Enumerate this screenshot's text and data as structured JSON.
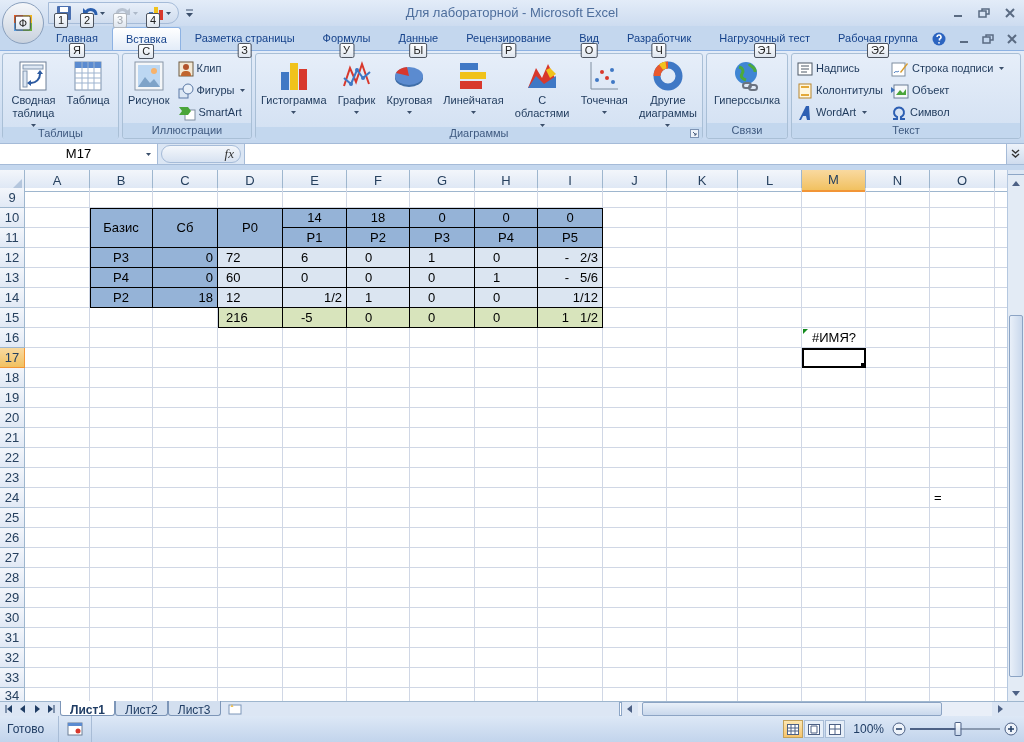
{
  "window": {
    "title": "Для лабораторной - Microsoft Excel",
    "office_keytip": "Ф",
    "quick_access": [
      {
        "keytip": "1",
        "disabled": false,
        "dropdown": false
      },
      {
        "keytip": "2",
        "disabled": false,
        "dropdown": true
      },
      {
        "keytip": "3",
        "disabled": true,
        "dropdown": true
      },
      {
        "keytip": "4",
        "disabled": false,
        "dropdown": true
      }
    ]
  },
  "tabs": [
    {
      "label": "Главная",
      "keytip": "Я",
      "selected": false
    },
    {
      "label": "Вставка",
      "keytip": "С",
      "selected": true
    },
    {
      "label": "Разметка страницы",
      "keytip": "З",
      "selected": false
    },
    {
      "label": "Формулы",
      "keytip": "У",
      "selected": false
    },
    {
      "label": "Данные",
      "keytip": "Ы",
      "selected": false
    },
    {
      "label": "Рецензирование",
      "keytip": "Р",
      "selected": false
    },
    {
      "label": "Вид",
      "keytip": "О",
      "selected": false
    },
    {
      "label": "Разработчик",
      "keytip": "Ч",
      "selected": false
    },
    {
      "label": "Нагрузочный тест",
      "keytip": "Э1",
      "selected": false
    },
    {
      "label": "Рабочая группа",
      "keytip": "Э2",
      "selected": false
    }
  ],
  "ribbon": {
    "groups": [
      {
        "title": "Таблицы",
        "launcher": false,
        "items": [
          {
            "kind": "large",
            "label": "Сводная таблица",
            "dropdown": true
          },
          {
            "kind": "large",
            "label": "Таблица",
            "dropdown": false
          }
        ]
      },
      {
        "title": "Иллюстрации",
        "launcher": false,
        "items": [
          {
            "kind": "large",
            "label": "Рисунок",
            "dropdown": false
          },
          {
            "kind": "small",
            "label": "Клип",
            "dropdown": false
          },
          {
            "kind": "small",
            "label": "Фигуры",
            "dropdown": true
          },
          {
            "kind": "small",
            "label": "SmartArt",
            "dropdown": false
          }
        ]
      },
      {
        "title": "Диаграммы",
        "launcher": true,
        "items": [
          {
            "kind": "large",
            "label": "Гистограмма",
            "dropdown": true
          },
          {
            "kind": "large",
            "label": "График",
            "dropdown": true
          },
          {
            "kind": "large",
            "label": "Круговая",
            "dropdown": true
          },
          {
            "kind": "large",
            "label": "Линейчатая",
            "dropdown": true
          },
          {
            "kind": "large",
            "label": "С областями",
            "dropdown": true
          },
          {
            "kind": "large",
            "label": "Точечная",
            "dropdown": true
          },
          {
            "kind": "large",
            "label": "Другие диаграммы",
            "dropdown": true
          }
        ]
      },
      {
        "title": "Связи",
        "launcher": false,
        "items": [
          {
            "kind": "large",
            "label": "Гиперссылка",
            "dropdown": false
          }
        ]
      },
      {
        "title": "Текст",
        "launcher": false,
        "items": [
          {
            "kind": "small",
            "label": "Надпись",
            "dropdown": false
          },
          {
            "kind": "small",
            "label": "Колонтитулы",
            "dropdown": false
          },
          {
            "kind": "small",
            "label": "WordArt",
            "dropdown": true
          },
          {
            "kind": "small",
            "label": "Строка подписи",
            "dropdown": true
          },
          {
            "kind": "small",
            "label": "Объект",
            "dropdown": false
          },
          {
            "kind": "small",
            "label": "Символ",
            "dropdown": false
          }
        ]
      }
    ]
  },
  "formula_bar": {
    "name_box": "M17",
    "fx": "fx"
  },
  "sheet": {
    "columns": [
      {
        "label": "A",
        "selected": false
      },
      {
        "label": "B",
        "selected": false
      },
      {
        "label": "C",
        "selected": false
      },
      {
        "label": "D",
        "selected": false
      },
      {
        "label": "E",
        "selected": false
      },
      {
        "label": "F",
        "selected": false
      },
      {
        "label": "G",
        "selected": false
      },
      {
        "label": "H",
        "selected": false
      },
      {
        "label": "I",
        "selected": false
      },
      {
        "label": "J",
        "selected": false
      },
      {
        "label": "K",
        "selected": false
      },
      {
        "label": "L",
        "selected": false
      },
      {
        "label": "M",
        "selected": true
      },
      {
        "label": "N",
        "selected": false
      },
      {
        "label": "O",
        "selected": false
      }
    ],
    "rows": [
      {
        "label": "9",
        "selected": false
      },
      {
        "label": "10",
        "selected": false,
        "cells": [
          null,
          {
            "kind": "span",
            "text": "Базис",
            "color": "#95b3d7",
            "error": false,
            "selected": false
          },
          {
            "kind": "span",
            "text": "Сб",
            "color": "#95b3d7",
            "error": false,
            "selected": false
          },
          {
            "kind": "span",
            "text": "P0",
            "color": "#95b3d7",
            "error": false,
            "selected": false
          },
          {
            "kind": "head",
            "text": "14",
            "color": "#95b3d7",
            "error": false,
            "selected": false
          },
          {
            "kind": "head",
            "text": "18",
            "color": "#95b3d7",
            "error": false,
            "selected": false
          },
          {
            "kind": "head",
            "text": "0",
            "color": "#95b3d7",
            "error": false,
            "selected": false
          },
          {
            "kind": "head",
            "text": "0",
            "color": "#95b3d7",
            "error": false,
            "selected": false
          },
          {
            "kind": "head",
            "text": "0",
            "color": "#95b3d7",
            "error": false,
            "selected": false
          }
        ]
      },
      {
        "label": "11",
        "selected": false,
        "cells": [
          null,
          {
            "kind": "merged"
          },
          {
            "kind": "merged"
          },
          {
            "kind": "merged"
          },
          {
            "kind": "head",
            "text": "P1",
            "color": "#95b3d7",
            "error": false,
            "selected": false
          },
          {
            "kind": "head",
            "text": "P2",
            "color": "#95b3d7",
            "error": false,
            "selected": false
          },
          {
            "kind": "head",
            "text": "P3",
            "color": "#95b3d7",
            "error": false,
            "selected": false
          },
          {
            "kind": "head",
            "text": "P4",
            "color": "#95b3d7",
            "error": false,
            "selected": false
          },
          {
            "kind": "head",
            "text": "P5",
            "color": "#95b3d7",
            "error": false,
            "selected": false
          }
        ]
      },
      {
        "label": "12",
        "selected": false,
        "cells": [
          null,
          {
            "kind": "head",
            "text": "P3",
            "color": "#95b3d7",
            "error": false,
            "selected": false
          },
          {
            "kind": "num",
            "text": "0",
            "color": "#95b3d7",
            "error": false,
            "selected": false
          },
          {
            "kind": "val",
            "text": "72",
            "color": "#dbe5f1",
            "error": false,
            "selected": false
          },
          {
            "kind": "val",
            "text": "6",
            "color": "#dbe5f1",
            "error": false,
            "selected": false
          },
          {
            "kind": "val",
            "text": "0",
            "color": "#dbe5f1",
            "error": false,
            "selected": false
          },
          {
            "kind": "val",
            "text": "1",
            "color": "#dbe5f1",
            "error": false,
            "selected": false
          },
          {
            "kind": "val",
            "text": "0",
            "color": "#dbe5f1",
            "error": false,
            "selected": false
          },
          {
            "kind": "num",
            "text": "-   2/3",
            "color": "#dbe5f1",
            "error": false,
            "selected": false
          }
        ]
      },
      {
        "label": "13",
        "selected": false,
        "cells": [
          null,
          {
            "kind": "head",
            "text": "P4",
            "color": "#95b3d7",
            "error": false,
            "selected": false
          },
          {
            "kind": "num",
            "text": "0",
            "color": "#95b3d7",
            "error": false,
            "selected": false
          },
          {
            "kind": "val",
            "text": "60",
            "color": "#dbe5f1",
            "error": false,
            "selected": false
          },
          {
            "kind": "val",
            "text": "0",
            "color": "#dbe5f1",
            "error": false,
            "selected": false
          },
          {
            "kind": "val",
            "text": "0",
            "color": "#dbe5f1",
            "error": false,
            "selected": false
          },
          {
            "kind": "val",
            "text": "0",
            "color": "#dbe5f1",
            "error": false,
            "selected": false
          },
          {
            "kind": "val",
            "text": "1",
            "color": "#dbe5f1",
            "error": false,
            "selected": false
          },
          {
            "kind": "num",
            "text": "-   5/6",
            "color": "#dbe5f1",
            "error": false,
            "selected": false
          }
        ]
      },
      {
        "label": "14",
        "selected": false,
        "cells": [
          null,
          {
            "kind": "head",
            "text": "P2",
            "color": "#95b3d7",
            "error": false,
            "selected": false
          },
          {
            "kind": "num",
            "text": "18",
            "color": "#95b3d7",
            "error": false,
            "selected": false
          },
          {
            "kind": "val",
            "text": "12",
            "color": "#dbe5f1",
            "error": false,
            "selected": false
          },
          {
            "kind": "num",
            "text": "1/2",
            "color": "#dbe5f1",
            "error": false,
            "selected": false
          },
          {
            "kind": "val",
            "text": "1",
            "color": "#dbe5f1",
            "error": false,
            "selected": false
          },
          {
            "kind": "val",
            "text": "0",
            "color": "#dbe5f1",
            "error": false,
            "selected": false
          },
          {
            "kind": "val",
            "text": "0",
            "color": "#dbe5f1",
            "error": false,
            "selected": false
          },
          {
            "kind": "num",
            "text": "1/12",
            "color": "#dbe5f1",
            "error": false,
            "selected": false
          }
        ]
      },
      {
        "label": "15",
        "selected": false,
        "cells": [
          null,
          null,
          null,
          {
            "kind": "val",
            "text": "216",
            "color": "#d8e4bc",
            "error": false,
            "selected": false
          },
          {
            "kind": "val",
            "text": "-5",
            "color": "#d8e4bc",
            "error": false,
            "selected": false
          },
          {
            "kind": "val",
            "text": "0",
            "color": "#d8e4bc",
            "error": false,
            "selected": false
          },
          {
            "kind": "val",
            "text": "0",
            "color": "#d8e4bc",
            "error": false,
            "selected": false
          },
          {
            "kind": "val",
            "text": "0",
            "color": "#d8e4bc",
            "error": false,
            "selected": false
          },
          {
            "kind": "num",
            "text": "1   1/2",
            "color": "#d8e4bc",
            "error": false,
            "selected": false
          }
        ]
      },
      {
        "label": "16",
        "selected": false,
        "cells": [
          null,
          null,
          null,
          null,
          null,
          null,
          null,
          null,
          null,
          null,
          null,
          null,
          {
            "kind": "head",
            "text": "#ИМЯ?",
            "error": true,
            "selected": false
          }
        ]
      },
      {
        "label": "17",
        "selected": true,
        "cells": [
          null,
          null,
          null,
          null,
          null,
          null,
          null,
          null,
          null,
          null,
          null,
          null,
          {
            "kind": "blank",
            "error": false,
            "selected": true
          }
        ]
      },
      {
        "label": "18",
        "selected": false
      },
      {
        "label": "19",
        "selected": false
      },
      {
        "label": "20",
        "selected": false
      },
      {
        "label": "21",
        "selected": false
      },
      {
        "label": "22",
        "selected": false
      },
      {
        "label": "23",
        "selected": false
      },
      {
        "label": "24",
        "selected": false,
        "cells": [
          null,
          null,
          null,
          null,
          null,
          null,
          null,
          null,
          null,
          null,
          null,
          null,
          null,
          null,
          {
            "kind": "val",
            "text": "=",
            "error": false,
            "selected": false
          }
        ]
      },
      {
        "label": "25",
        "selected": false
      },
      {
        "label": "26",
        "selected": false
      },
      {
        "label": "27",
        "selected": false
      },
      {
        "label": "28",
        "selected": false
      },
      {
        "label": "29",
        "selected": false
      },
      {
        "label": "30",
        "selected": false
      },
      {
        "label": "31",
        "selected": false
      },
      {
        "label": "32",
        "selected": false
      },
      {
        "label": "33",
        "selected": false
      },
      {
        "label": "34",
        "selected": false
      }
    ]
  },
  "sheet_tabs": [
    {
      "label": "Лист1",
      "selected": true
    },
    {
      "label": "Лист2",
      "selected": false
    },
    {
      "label": "Лист3",
      "selected": false
    }
  ],
  "status_bar": {
    "text": "Готово",
    "views": [
      {
        "selected": true
      },
      {
        "selected": false
      },
      {
        "selected": false
      }
    ],
    "zoom": {
      "reading": "100%",
      "level": 0.53
    }
  }
}
